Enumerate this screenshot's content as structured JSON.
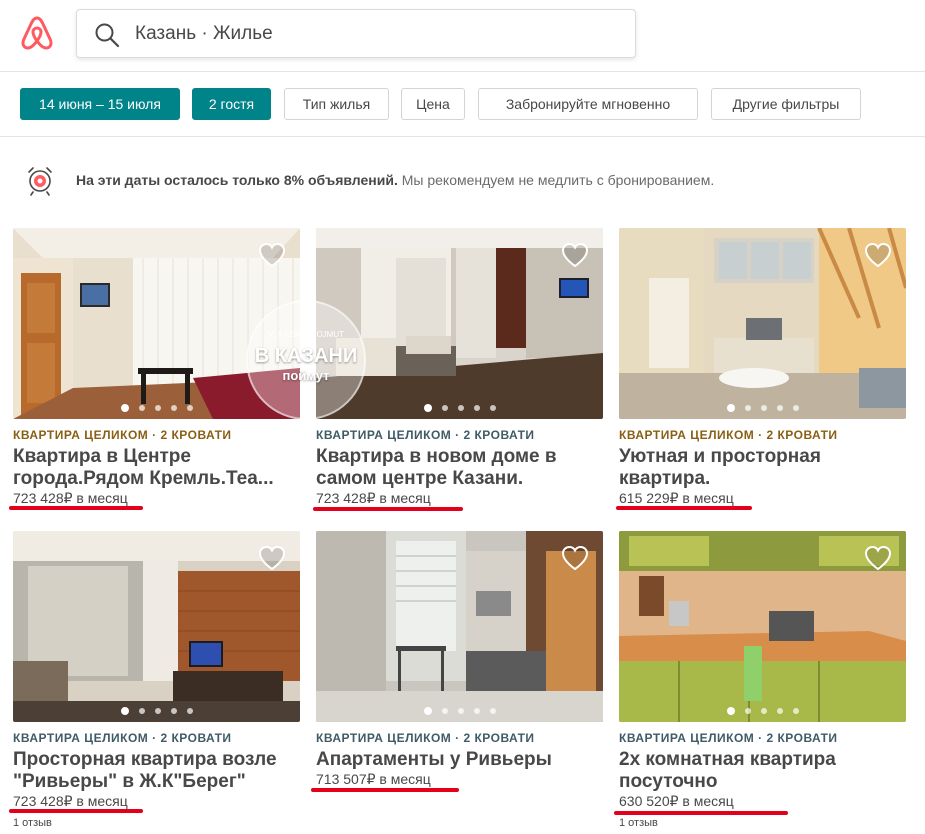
{
  "search": {
    "text": "Казань · Жилье"
  },
  "filters": [
    {
      "label": "14 июня – 15 июля",
      "active": true
    },
    {
      "label": "2 гостя",
      "active": true
    },
    {
      "label": "Тип жилья",
      "active": false
    },
    {
      "label": "Цена",
      "active": false
    },
    {
      "label": "Забронируйте мгновенно",
      "active": false
    },
    {
      "label": "Другие фильтры",
      "active": false
    }
  ],
  "notice": {
    "bold": "На эти даты осталось только 8% объявлений.",
    "text": "Мы рекомендуем не медлить с бронированием."
  },
  "watermark": {
    "line1": "V_KAZANI_POJMUT",
    "line2": "В КАЗАНИ",
    "line3": "поймут"
  },
  "listings": [
    {
      "type": "КВАРТИРА ЦЕЛИКОМ · 2 КРОВАТИ",
      "title_line1": "Квартира в Центре",
      "title_line2": "города.Рядом Кремль.Теа...",
      "price": "723 428₽",
      "period": "в месяц",
      "reviews": ""
    },
    {
      "type": "КВАРТИРА ЦЕЛИКОМ · 2 КРОВАТИ",
      "title_line1": "Квартира в новом доме в",
      "title_line2": "самом центре Казани.",
      "price": "723 428₽",
      "period": "в месяц",
      "reviews": ""
    },
    {
      "type": "КВАРТИРА ЦЕЛИКОМ · 2 КРОВАТИ",
      "title_line1": "Уютная и просторная",
      "title_line2": "квартира.",
      "price": "615 229₽",
      "period": "в месяц",
      "reviews": ""
    },
    {
      "type": "КВАРТИРА ЦЕЛИКОМ · 2 КРОВАТИ",
      "title_line1": "Просторная квартира возле",
      "title_line2": "\"Ривьеры\" в Ж.К\"Берег\"",
      "price": "723 428₽",
      "period": "в месяц",
      "reviews": "1 отзыв"
    },
    {
      "type": "КВАРТИРА ЦЕЛИКОМ · 2 КРОВАТИ",
      "title_line1": "Апартаменты у Ривьеры",
      "title_line2": "",
      "price": "713 507₽",
      "period": "в месяц",
      "reviews": ""
    },
    {
      "type": "КВАРТИРА ЦЕЛИКОМ · 2 КРОВАТИ",
      "title_line1": "2х комнатная квартира",
      "title_line2": "посуточно",
      "price": "630 520₽",
      "period": "в месяц",
      "reviews": "1 отзыв"
    }
  ],
  "colors": {
    "brand": "#FF5A5F",
    "accent": "#008489",
    "highlight": "#E3001B",
    "type_label": "#8A5F13"
  },
  "icons": [
    "airbnb-logo-icon",
    "search-icon",
    "alarm-target-icon",
    "heart-icon"
  ]
}
